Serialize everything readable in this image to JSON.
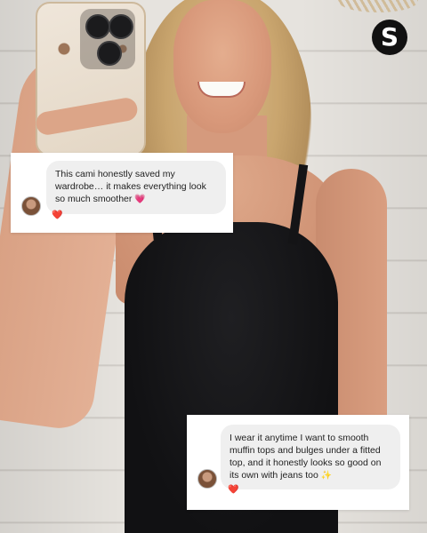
{
  "brand": {
    "logo_letter": "S"
  },
  "comments": [
    {
      "text": "This cami honestly saved my wardrobe… it makes everything look so much smoother",
      "emoji": "💗",
      "reaction": "❤️"
    },
    {
      "text": "I wear it anytime I want to smooth muffin tops and bulges under a fitted top, and it honestly looks so good on its own with jeans too",
      "emoji": "✨",
      "reaction": "❤️"
    }
  ],
  "colors": {
    "logo_bg": "#111111",
    "bubble_bg": "#efefef",
    "heart": "#e02a2a",
    "top": "#111113"
  }
}
